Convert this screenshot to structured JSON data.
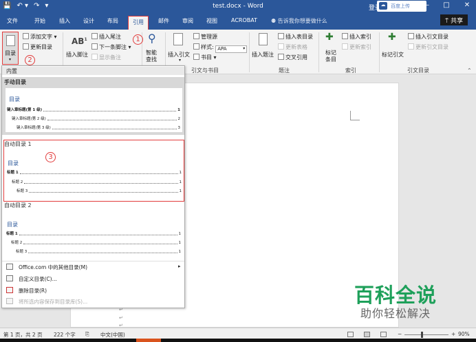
{
  "window": {
    "title": "test.docx - Word",
    "login": "登录",
    "controls": [
      "▣",
      "—",
      "□",
      "✕"
    ]
  },
  "qat": {
    "save": "💾",
    "undo": "↶ ▾",
    "redo": "↷",
    "customize": "▾"
  },
  "tabs": [
    "文件",
    "开始",
    "插入",
    "设计",
    "布局",
    "引用",
    "邮件",
    "审阅",
    "视图",
    "ACROBAT"
  ],
  "active_tab": "引用",
  "tellme": "⚉ 告诉我你想要做什么",
  "share_upload": "百度上传",
  "share": "⍑ 共享",
  "ribbon": {
    "toc_label": "目录",
    "add_text": "添加文字 ▾",
    "update_toc": "更新目录",
    "insert_footnote": "插入脚注",
    "insert_endnote": "插入尾注",
    "next_footnote": "下一条脚注 ▾",
    "show_notes": "显示备注",
    "smart_lookup": "智能\n查找",
    "insert_citation": "插入引文",
    "manage_sources": "管理源",
    "style_label": "样式:",
    "style_value": "APA",
    "bibliography": "书目 ▾",
    "insert_caption": "插入题注",
    "insert_table_figures": "插入表目录",
    "update_table": "更新表格",
    "cross_reference": "交叉引用",
    "mark_entry": "标记\n条目",
    "insert_index": "插入索引",
    "update_index": "更新索引",
    "mark_citation": "标记引文",
    "insert_toa": "插入引文目录",
    "update_toa": "更新引文目录",
    "groups": {
      "citations": "引文与书目",
      "captions": "题注",
      "index": "索引",
      "toa": "引文目录"
    }
  },
  "annotations": {
    "one": "1",
    "two": "2",
    "three": "3"
  },
  "dropdown": {
    "section": "内置",
    "manual": {
      "header": "手动目录",
      "toc_title": "目录",
      "lines": [
        {
          "text": "键入章标题(第 1 级)",
          "page": "1"
        },
        {
          "text": "键入章标题(第 2 级)",
          "page": "2"
        },
        {
          "text": "键入章标题(第 3 级)",
          "page": "3"
        }
      ]
    },
    "auto1": {
      "header": "自动目录 1",
      "toc_title": "目录",
      "lines": [
        {
          "text": "标题 1",
          "page": "1"
        },
        {
          "text": "标题 2",
          "page": "1"
        },
        {
          "text": "标题 3",
          "page": "1"
        }
      ]
    },
    "auto2": {
      "header": "自动目录 2",
      "toc_title": "目录",
      "lines": [
        {
          "text": "标题 1",
          "page": "1"
        },
        {
          "text": "标题 2",
          "page": "1"
        },
        {
          "text": "标题 3",
          "page": "1"
        }
      ]
    },
    "menu": [
      {
        "label": "Office.com 中的其他目录(M)",
        "submenu": "▸",
        "enabled": true
      },
      {
        "label": "自定义目录(C)...",
        "enabled": true
      },
      {
        "label": "删除目录(R)",
        "enabled": true
      },
      {
        "label": "将所选内容保存到目录库(S)...",
        "enabled": false
      }
    ]
  },
  "status": {
    "page": "第 1 页，共 2 页",
    "words": "222 个字",
    "lang": "中文(中国)",
    "zoom_minus": "−",
    "zoom_plus": "+",
    "zoom": "90%"
  },
  "watermark": {
    "title": "百科全说",
    "subtitle": "助你轻松解决"
  }
}
